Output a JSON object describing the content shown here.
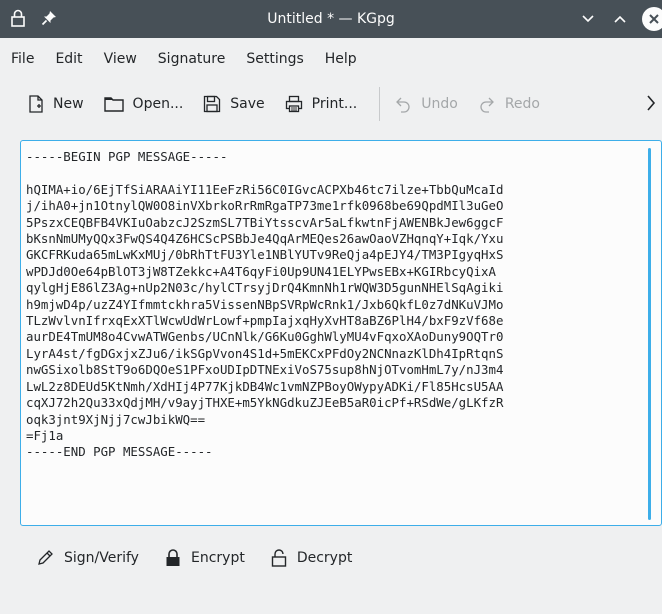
{
  "window": {
    "title": "Untitled * — KGpg",
    "icons": [
      "app-lock-icon",
      "pin-icon",
      "minimize-icon",
      "maximize-icon",
      "close-icon"
    ]
  },
  "menu": [
    "File",
    "Edit",
    "View",
    "Signature",
    "Settings",
    "Help"
  ],
  "toolbar": {
    "new": "New",
    "open": "Open...",
    "save": "Save",
    "print": "Print...",
    "undo": "Undo",
    "redo": "Redo"
  },
  "editor": {
    "text": "-----BEGIN PGP MESSAGE-----\n\nhQIMA+io/6EjTfSiARAAiYI11EeFzRi56C0IGvcACPXb46tc7ilze+TbbQuMcaId\nj/ihA0+jn1OtnylQW0O8inVXbrkoRrRmRgaTP73me1rfk0968be69QpdMIl3uGeO\n5PszxCEQBFB4VKIuOabzcJ2SzmSL7TBiYtsscvAr5aLfkwtnFjAWENBkJew6ggcF\nbKsnNmUMyQQx3FwQS4Q4Z6HCScPSBbJe4QqArMEQes26awOaoVZHqnqY+Iqk/Yxu\nGKCFRKuda65mLwKxMUj/0bRhTtFU3Yle1NBlYUTv9ReQja4pEJY4/TM3PIgyqHxS\nwPDJd0Oe64pBlOT3jW8TZekkc+A4T6qyFi0Up9UN41ELYPwsEBx+KGIRbcyQixA\nqylgHjE86lZ3Ag+nUp2N03c/hylCTrsyjDrQ4KmnNh1rWQW3D5gunNHElSqAgiki\nh9mjwD4p/uzZ4YIfmmtckhra5VissenNBpSVRpWcRnk1/Jxb6QkfL0z7dNKuVJMo\nTLzWvlvnIfrxqExXTlWcwUdWrLowf+pmpIajxqHyXvHT8aBZ6PlH4/bxF9zVf68e\naurDE4TmUM8o4CvwATWGenbs/UCnNlk/G6Ku0GghWlyMU4vFqxoXAoDuny9OQTr0\nLyrA4st/fgDGxjxZJu6/ikSGpVvon4S1d+5mEKCxPFdOy2NCNnazKlDh4IpRtqnS\nnwGSixolb8StT9o6DQOeS1PFxoUDIpDTNExiVoS75sup8hNjOTvomHmL7y/nJ3m4\nLwL2z8DEUd5KtNmh/XdHIj4P77KjkDB4Wc1vmNZPBoyOWypyADKi/Fl85HcsU5AA\ncqXJ72h2Qu33xQdjMH/v9ayjTHXE+m5YkNGdkuZJEeB5aR0icPf+RSdWe/gLKfzR\noqk3jnt9XjNjj7cwJbikWQ==\n=Fj1a\n-----END PGP MESSAGE-----"
  },
  "bottom": {
    "sign": "Sign/Verify",
    "encrypt": "Encrypt",
    "decrypt": "Decrypt"
  },
  "colors": {
    "titlebar": "#475057",
    "accent": "#3daee9",
    "background": "#eff0f1"
  }
}
